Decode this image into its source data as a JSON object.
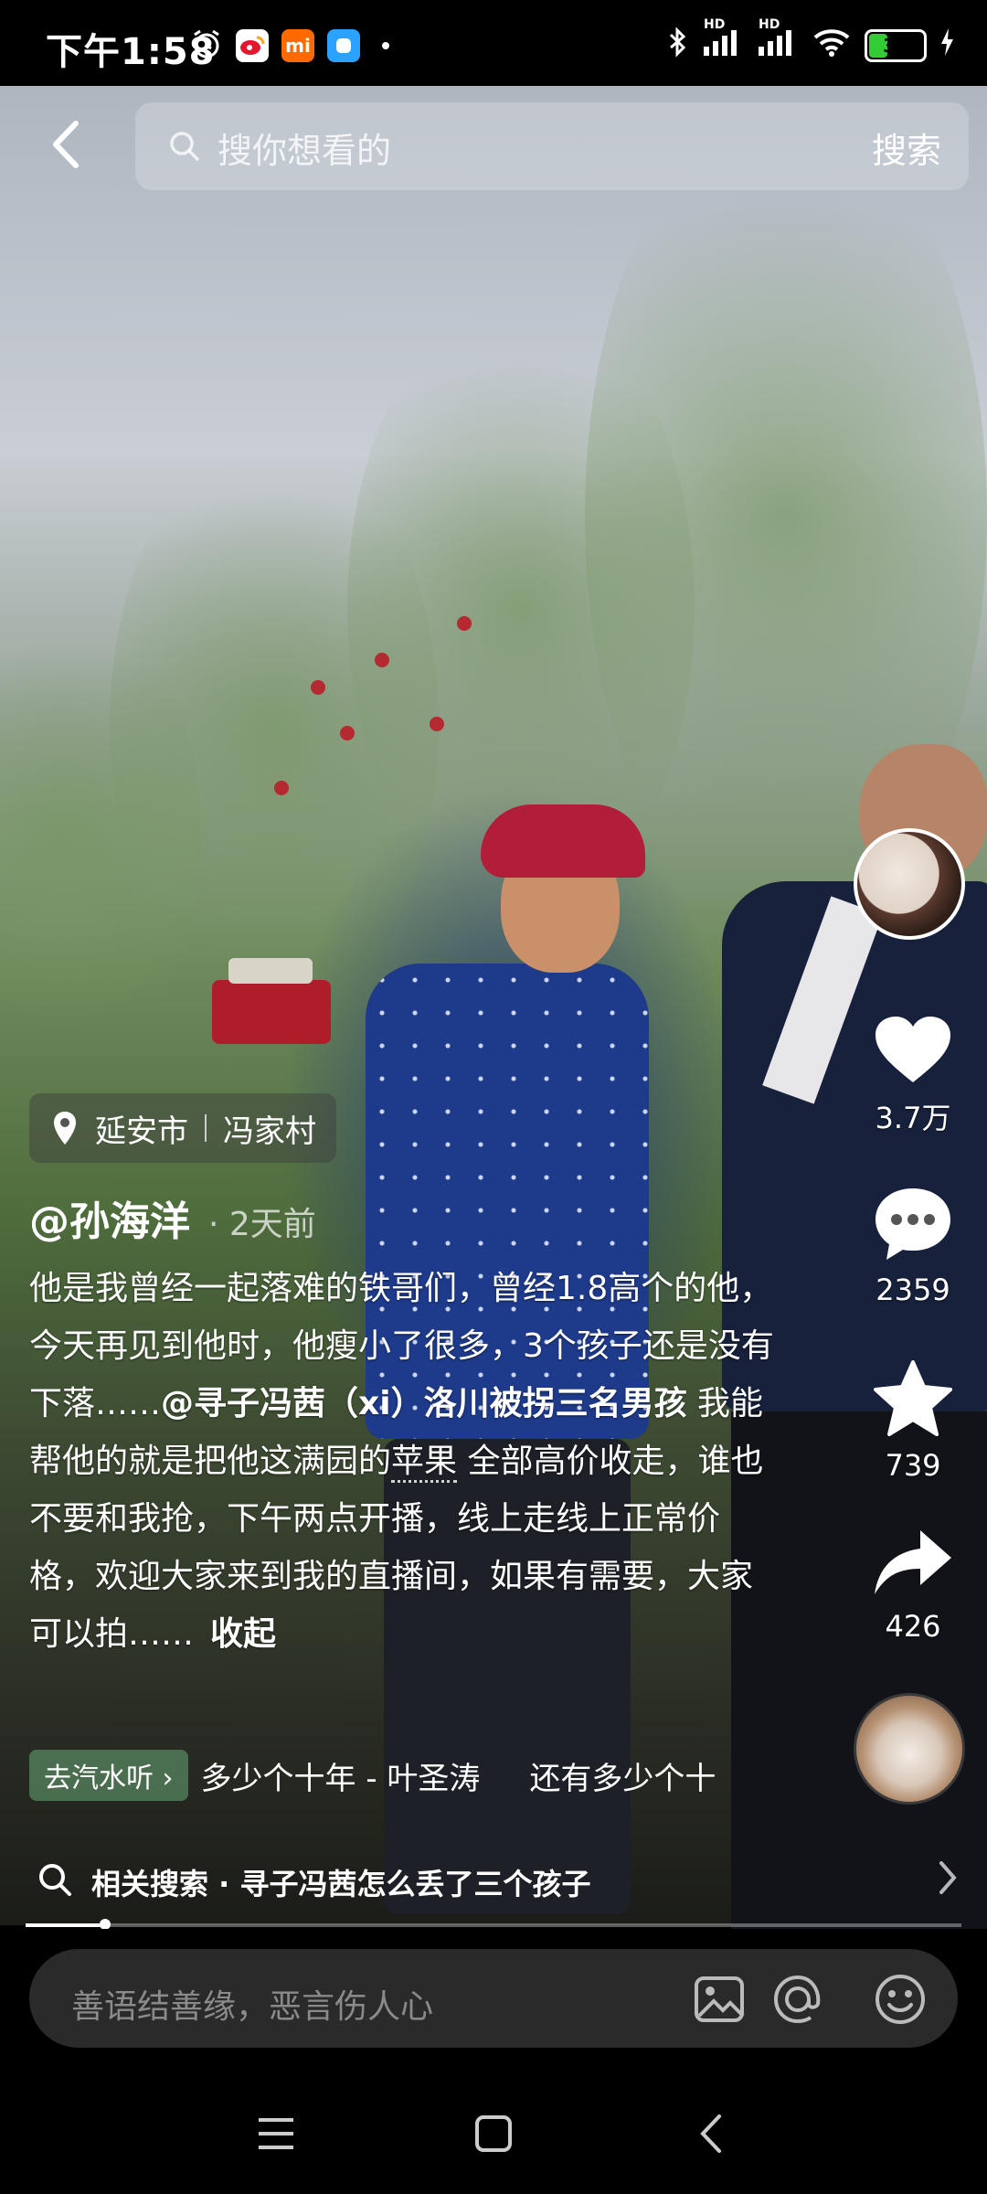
{
  "status_bar": {
    "time": "下午1:58",
    "battery": "33",
    "hd1": "HD",
    "hd2": "HD",
    "app_icons": [
      "alarm-icon",
      "weibo-icon",
      "mi-icon",
      "app-icon",
      "dot"
    ]
  },
  "top_bar": {
    "search_placeholder": "搜你想看的",
    "search_button": "搜索"
  },
  "rail": {
    "likes": "3.7万",
    "comments": "2359",
    "favorites": "739",
    "shares": "426"
  },
  "location": {
    "city": "延安市",
    "village": "冯家村"
  },
  "author": {
    "name": "@孙海洋",
    "time": "· 2天前"
  },
  "caption": {
    "part1": "他是我曾经一起落难的铁哥们，曾经1.8高个的他，今天再见到他时，他瘦小了很多，3个孩子还是没有下落……",
    "mention": "@寻子冯茜（xi）洛川被拐三名男孩",
    "part2": " 我能帮他的就是把他这满园的",
    "apple": "苹果",
    "part3": "全部高价收走，谁也不要和我抢，下午两点开播，线上走线上正常价格，欢迎大家来到我的直播间，如果有需要，大家可以拍……",
    "collapse": "收起"
  },
  "music": {
    "tag": "去汽水听",
    "track": "多少个十年 - 叶圣涛",
    "track2": "还有多少个十"
  },
  "related": {
    "text": "相关搜索 · 寻子冯茜怎么丢了三个孩子"
  },
  "progress": 0.085,
  "comment_bar": {
    "placeholder": "善语结善缘，恶言伤人心"
  },
  "colors": {
    "background": "#000000",
    "cap": "#b21e3a",
    "shirt": "#1e3a8a",
    "comment_box": "#2a2a2a"
  }
}
